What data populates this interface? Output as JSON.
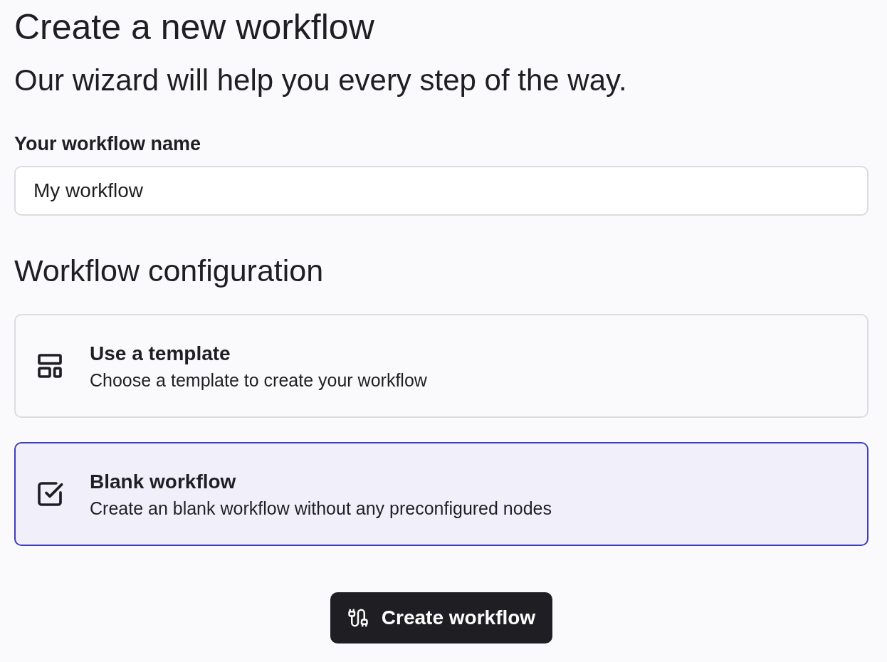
{
  "title": "Create a new workflow",
  "subtitle": "Our wizard will help you every step of the way.",
  "name_field": {
    "label": "Your workflow name",
    "value": "My workflow"
  },
  "configuration": {
    "heading": "Workflow configuration",
    "options": [
      {
        "kind": "template",
        "title": "Use a template",
        "description": "Choose a template to create your workflow",
        "selected": false
      },
      {
        "kind": "blank",
        "title": "Blank workflow",
        "description": "Create an blank workflow without any preconfigured nodes",
        "selected": true
      }
    ]
  },
  "submit_button": {
    "label": "Create workflow"
  }
}
